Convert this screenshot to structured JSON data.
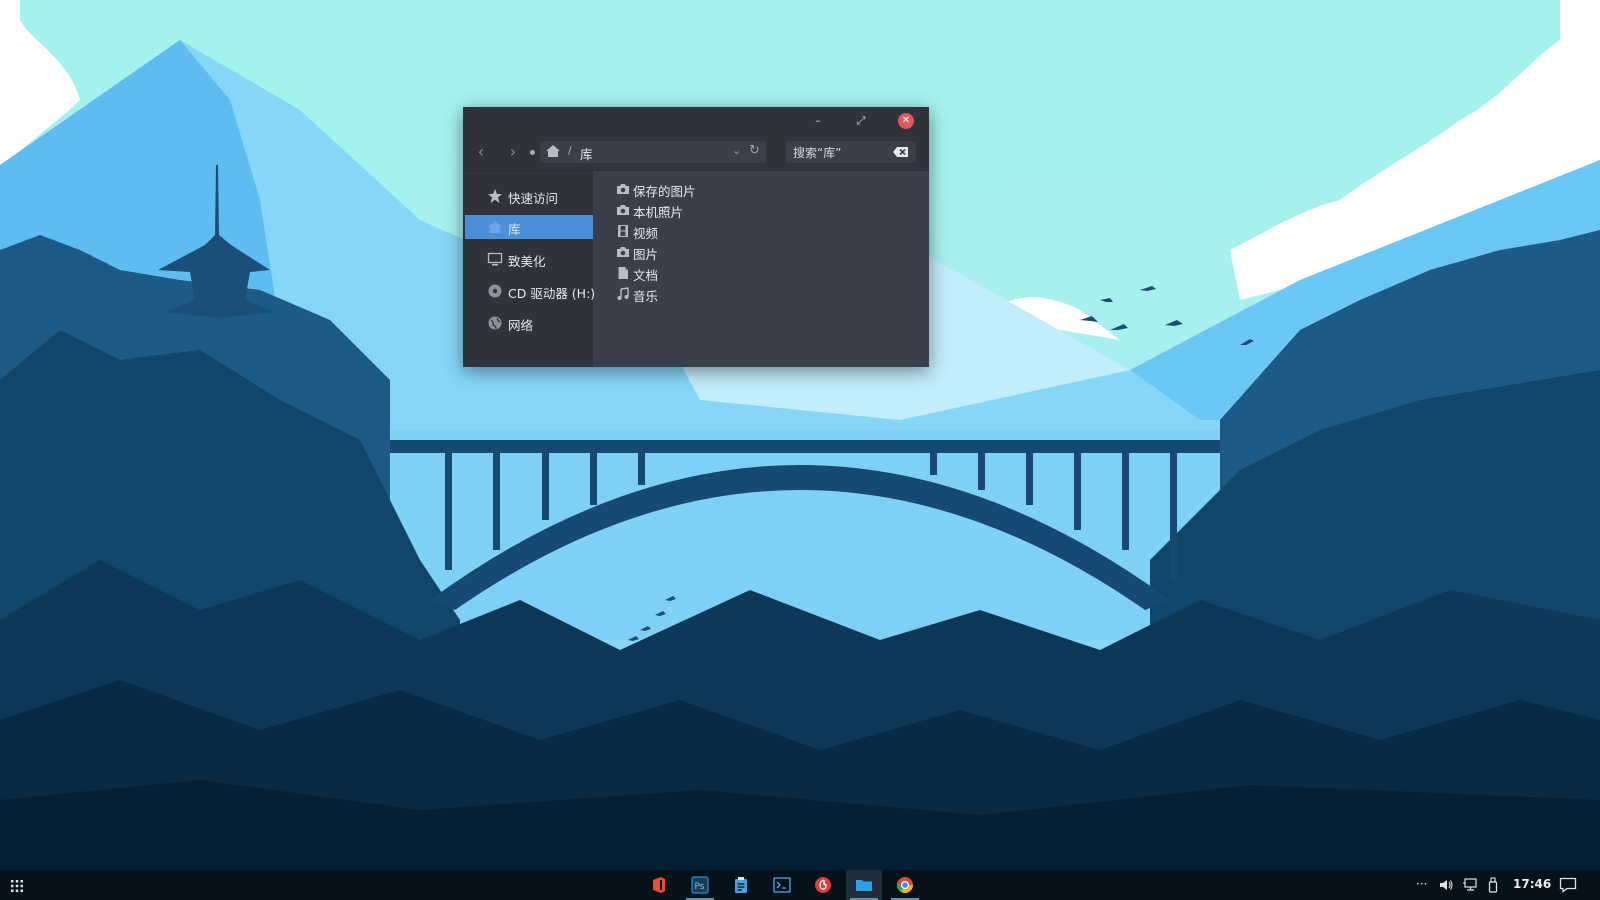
{
  "window": {
    "controls": {
      "minimize": "–",
      "maximize": "⤢",
      "close": "✕"
    },
    "toolbar": {
      "back_icon": "‹",
      "forward_icon": "›",
      "path_separator": "/",
      "path_label": "库",
      "dropdown_icon": "⌄",
      "refresh_icon": "↻",
      "search_placeholder": "搜索“库”"
    },
    "sidebar": {
      "items": [
        {
          "label": "快速访问",
          "icon": "star-icon"
        },
        {
          "label": "库",
          "icon": "home-icon",
          "active": true
        },
        {
          "label": "致美化",
          "icon": "monitor-icon"
        },
        {
          "label": "CD 驱动器 (H:)",
          "icon": "disc-icon"
        },
        {
          "label": "网络",
          "icon": "globe-icon"
        }
      ]
    },
    "files": [
      {
        "label": "保存的图片",
        "icon": "camera-icon"
      },
      {
        "label": "本机照片",
        "icon": "camera-icon"
      },
      {
        "label": "视频",
        "icon": "film-icon"
      },
      {
        "label": "图片",
        "icon": "camera-icon"
      },
      {
        "label": "文档",
        "icon": "document-icon"
      },
      {
        "label": "音乐",
        "icon": "music-icon"
      }
    ]
  },
  "taskbar": {
    "apps": [
      {
        "name": "office",
        "color": "#e8512a"
      },
      {
        "name": "photoshop",
        "color": "#2b8fd6"
      },
      {
        "name": "clipboard",
        "color": "#4aa3e0"
      },
      {
        "name": "terminal",
        "color": "#5aa9e6"
      },
      {
        "name": "netease-music",
        "color": "#e23a3a"
      },
      {
        "name": "file-manager",
        "color": "#29a3e8",
        "active": true
      },
      {
        "name": "chrome",
        "color": "#f2b50d"
      }
    ],
    "tray": {
      "more": "···",
      "time": "17:46"
    }
  },
  "colors": {
    "sky": "#a3f3ec",
    "accent": "#4a90d9",
    "window_bg": "#3b3f4b",
    "taskbar_bg": "#06121a"
  }
}
